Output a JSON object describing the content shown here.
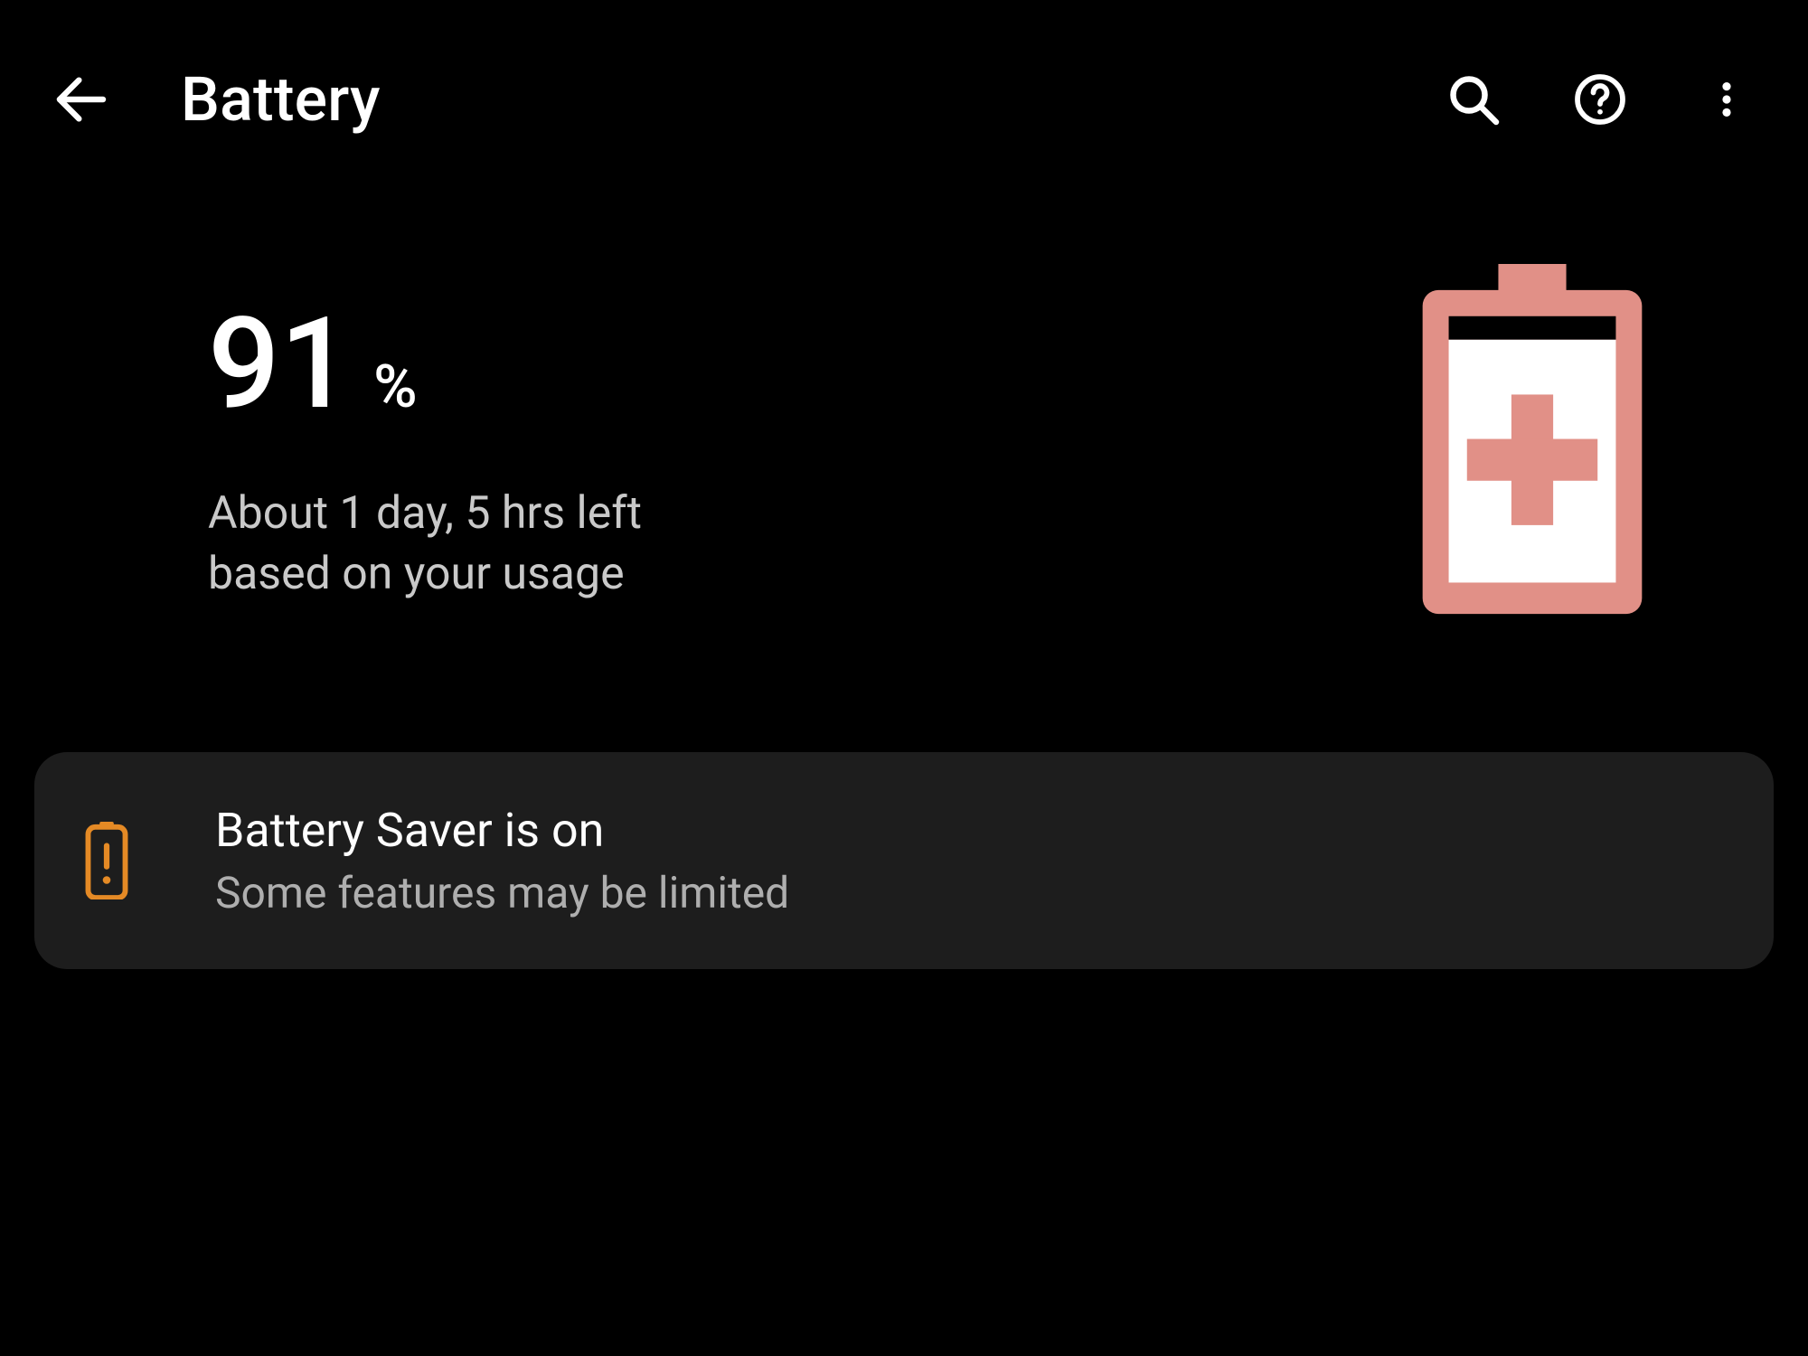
{
  "appbar": {
    "title": "Battery"
  },
  "summary": {
    "percent_value": "91",
    "percent_unit": "%",
    "estimate_line1": "About 1 day, 5 hrs left",
    "estimate_line2": "based on your usage"
  },
  "notice": {
    "title": "Battery Saver is on",
    "subtitle": "Some features may be limited"
  },
  "colors": {
    "battery_accent": "#e19087",
    "warning_accent": "#e58a25"
  }
}
